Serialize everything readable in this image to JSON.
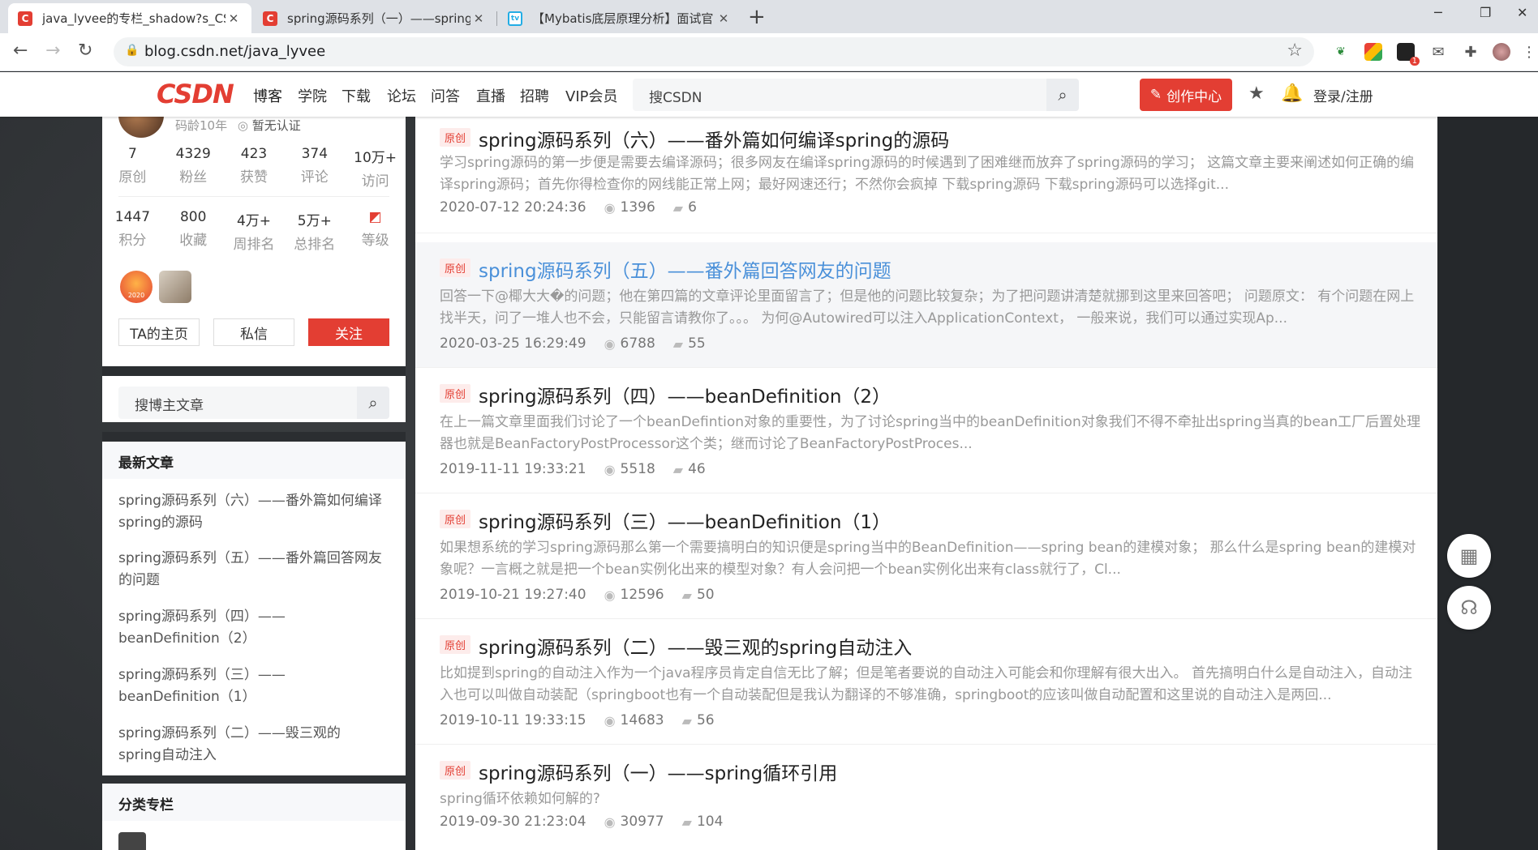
{
  "browser": {
    "tabs": [
      {
        "title": "java_lyvee的专栏_shadow?s_CSDN博客",
        "icon": "csdn-favicon",
        "active": true
      },
      {
        "title": "spring源码系列（一）——spring循环引用",
        "icon": "csdn-favicon",
        "active": false
      },
      {
        "title": "【Mybatis底层原理分析】面试官",
        "icon": "bilibili-favicon",
        "active": false
      }
    ],
    "url": "blog.csdn.net/java_lyvee",
    "extension_badge": "1"
  },
  "site_nav": {
    "logo": "CSDN",
    "items": [
      "博客",
      "学院",
      "下载",
      "论坛",
      "问答",
      "直播",
      "招聘",
      "VIP会员"
    ],
    "search_placeholder": "搜CSDN",
    "create_button": "创作中心",
    "login": "登录/注册"
  },
  "profile": {
    "age_label": "码龄10年",
    "cert_label": "暂无认证",
    "stats_row1": [
      {
        "value": "7",
        "label": "原创"
      },
      {
        "value": "4329",
        "label": "粉丝"
      },
      {
        "value": "423",
        "label": "获赞"
      },
      {
        "value": "374",
        "label": "评论"
      },
      {
        "value": "10万+",
        "label": "访问"
      }
    ],
    "stats_row2": [
      {
        "value": "1447",
        "label": "积分"
      },
      {
        "value": "800",
        "label": "收藏"
      },
      {
        "value": "4万+",
        "label": "周排名"
      },
      {
        "value": "5万+",
        "label": "总排名"
      },
      {
        "value": "",
        "label": "等级"
      }
    ],
    "badge_year": "2020",
    "buttons": {
      "home": "TA的主页",
      "message": "私信",
      "follow": "关注"
    }
  },
  "blog_search": {
    "placeholder": "搜博主文章"
  },
  "recent": {
    "title": "最新文章",
    "items": [
      "spring源码系列（六）——番外篇如何编译spring的源码",
      "spring源码系列（五）——番外篇回答网友的问题",
      "spring源码系列（四）——beanDefinition（2）",
      "spring源码系列（三）——beanDefinition（1）",
      "spring源码系列（二）——毁三观的spring自动注入"
    ]
  },
  "category": {
    "title": "分类专栏"
  },
  "articles": [
    {
      "tag": "原创",
      "title": "spring源码系列（六）——番外篇如何编译spring的源码",
      "desc": "学习spring源码的第一步便是需要去编译源码；很多网友在编译spring源码的时候遇到了困难继而放弃了spring源码的学习； 这篇文章主要来阐述如何正确的编译spring源码；首先你得检查你的网线能正常上网；最好网速还行；不然你会疯掉 下载spring源码 下载spring源码可以选择git...",
      "date": "2020-07-12 20:24:36",
      "views": "1396",
      "comments": "6"
    },
    {
      "tag": "原创",
      "title": "spring源码系列（五）——番外篇回答网友的问题",
      "desc": "回答一下@椰大大�的问题；他在第四篇的文章评论里面留言了；但是他的问题比较复杂；为了把问题讲清楚就挪到这里来回答吧； 问题原文： 有个问题在网上找半天，问了一堆人也不会，只能留言请教你了。。。 为何@Autowired可以注入ApplicationContext， 一般来说，我们可以通过实现Ap...",
      "date": "2020-03-25 16:29:49",
      "views": "6788",
      "comments": "55"
    },
    {
      "tag": "原创",
      "title": "spring源码系列（四）——beanDefinition（2）",
      "desc": "在上一篇文章里面我们讨论了一个beanDefintion对象的重要性，为了讨论spring当中的beanDefinition对象我们不得不牵扯出spring当真的bean工厂后置处理器也就是BeanFactoryPostProcessor这个类；继而讨论了BeanFactoryPostProces...",
      "date": "2019-11-11 19:33:21",
      "views": "5518",
      "comments": "46"
    },
    {
      "tag": "原创",
      "title": "spring源码系列（三）——beanDefinition（1）",
      "desc": "如果想系统的学习spring源码那么第一个需要搞明白的知识便是spring当中的BeanDefinition——spring bean的建模对象； 那么什么是spring bean的建模对象呢？一言概之就是把一个bean实例化出来的模型对象？有人会问把一个bean实例化出来有class就行了，Cl...",
      "date": "2019-10-21 19:27:40",
      "views": "12596",
      "comments": "50"
    },
    {
      "tag": "原创",
      "title": "spring源码系列（二）——毁三观的spring自动注入",
      "desc": "比如提到spring的自动注入作为一个java程序员肯定自信无比了解；但是笔者要说的自动注入可能会和你理解有很大出入。 首先搞明白什么是自动注入，自动注入也可以叫做自动装配（springboot也有一个自动装配但是我认为翻译的不够准确，springboot的应该叫做自动配置和这里说的自动注入是两回...",
      "date": "2019-10-11 19:33:15",
      "views": "14683",
      "comments": "56"
    },
    {
      "tag": "原创",
      "title": "spring源码系列（一）——spring循环引用",
      "desc": "spring循环依赖如何解的?",
      "date": "2019-09-30 21:23:04",
      "views": "30977",
      "comments": "104"
    }
  ],
  "colors": {
    "brand_red": "#e33e33",
    "link_blue": "#4a90d9"
  }
}
